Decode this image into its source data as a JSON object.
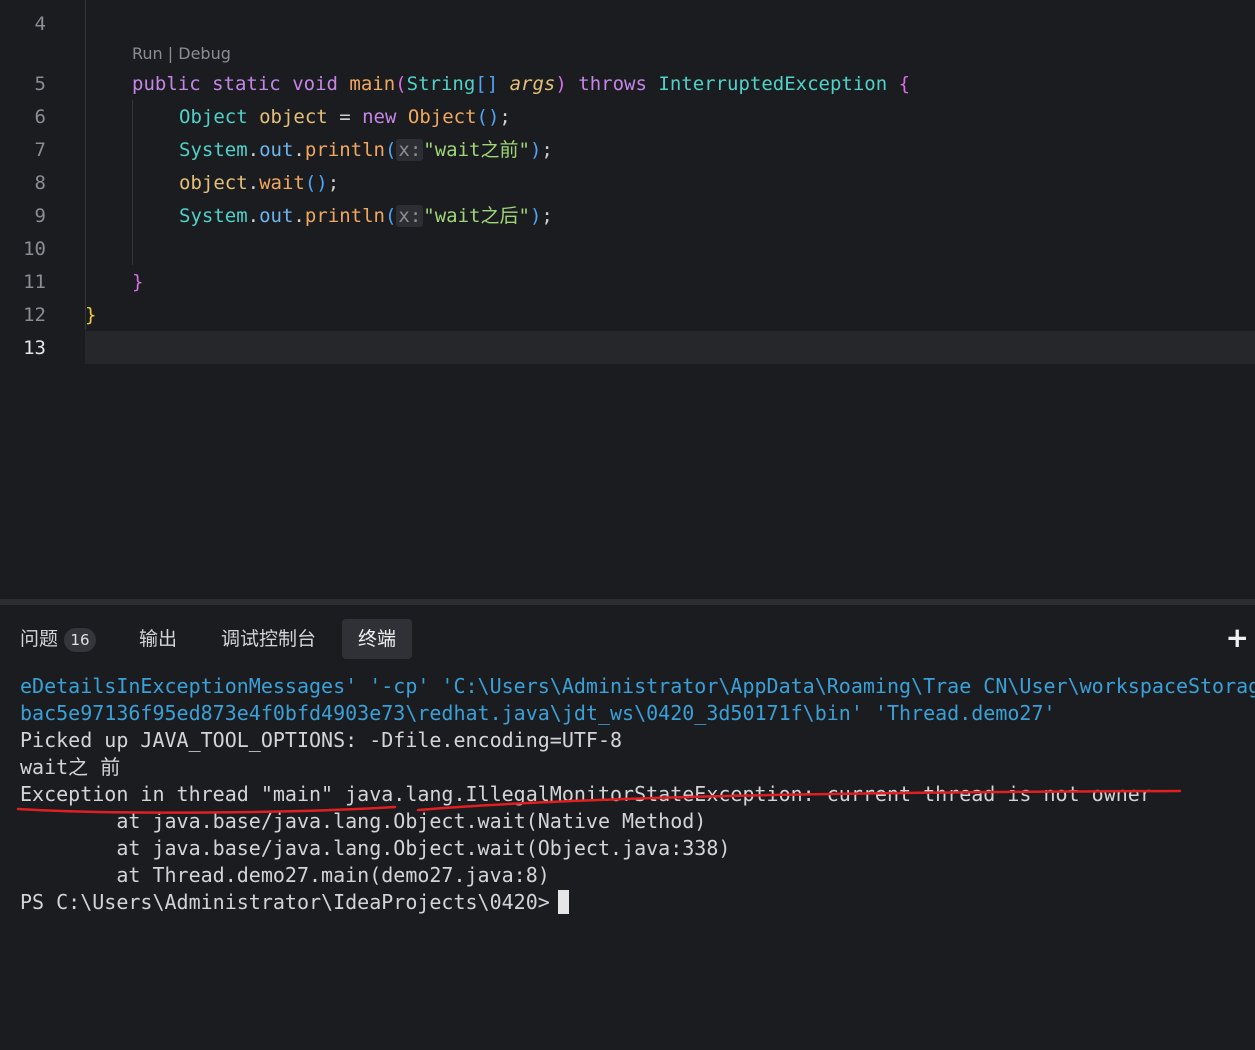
{
  "editor": {
    "codelens": "Run | Debug",
    "line_numbers": [
      "4",
      "5",
      "6",
      "7",
      "8",
      "9",
      "10",
      "11",
      "12",
      "13"
    ],
    "active_line": "13",
    "lines": {
      "l5": [
        "public",
        "static",
        "void",
        "main",
        "(",
        "String",
        "[]",
        "args",
        ")",
        "throws",
        "InterruptedException",
        "{"
      ],
      "l6": [
        "Object",
        "object",
        "=",
        "new",
        "Object",
        "()",
        ";"
      ],
      "l7": [
        "System",
        ".",
        "out",
        ".",
        "println",
        "(",
        "x:",
        "\"wait之前\"",
        ")",
        ";"
      ],
      "l8": [
        "object",
        ".",
        "wait",
        "()",
        ";"
      ],
      "l9": [
        "System",
        ".",
        "out",
        ".",
        "println",
        "(",
        "x:",
        "\"wait之后\"",
        ")",
        ";"
      ],
      "l11": [
        "}"
      ],
      "l12": [
        "}"
      ]
    }
  },
  "panel": {
    "tabs": [
      {
        "label": "问题",
        "badge": "16"
      },
      {
        "label": "输出"
      },
      {
        "label": "调试控制台"
      },
      {
        "label": "终端"
      }
    ],
    "active_tab": "终端",
    "add_icon": "plus-icon",
    "terminal": {
      "lines": [
        "eDetailsInExceptionMessages' '-cp' 'C:\\Users\\Administrator\\AppData\\Roaming\\Trae CN\\User\\workspaceStorag",
        "bac5e97136f95ed873e4f0bfd4903e73\\redhat.java\\jdt_ws\\0420_3d50171f\\bin' 'Thread.demo27'",
        "Picked up JAVA_TOOL_OPTIONS: -Dfile.encoding=UTF-8",
        "wait之 前",
        "Exception in thread \"main\" java.lang.IllegalMonitorStateException: current thread is not owner",
        "        at java.base/java.lang.Object.wait(Native Method)",
        "        at java.base/java.lang.Object.wait(Object.java:338)",
        "        at Thread.demo27.main(demo27.java:8)",
        "PS C:\\Users\\Administrator\\IdeaProjects\\0420>"
      ]
    },
    "annotation_color": "#e02020"
  },
  "colors": {
    "background": "#1b1c1f",
    "keyword": "#c586e8",
    "type": "#4fd2c9",
    "string": "#9fd67a",
    "terminal_path": "#3aa0d8"
  }
}
